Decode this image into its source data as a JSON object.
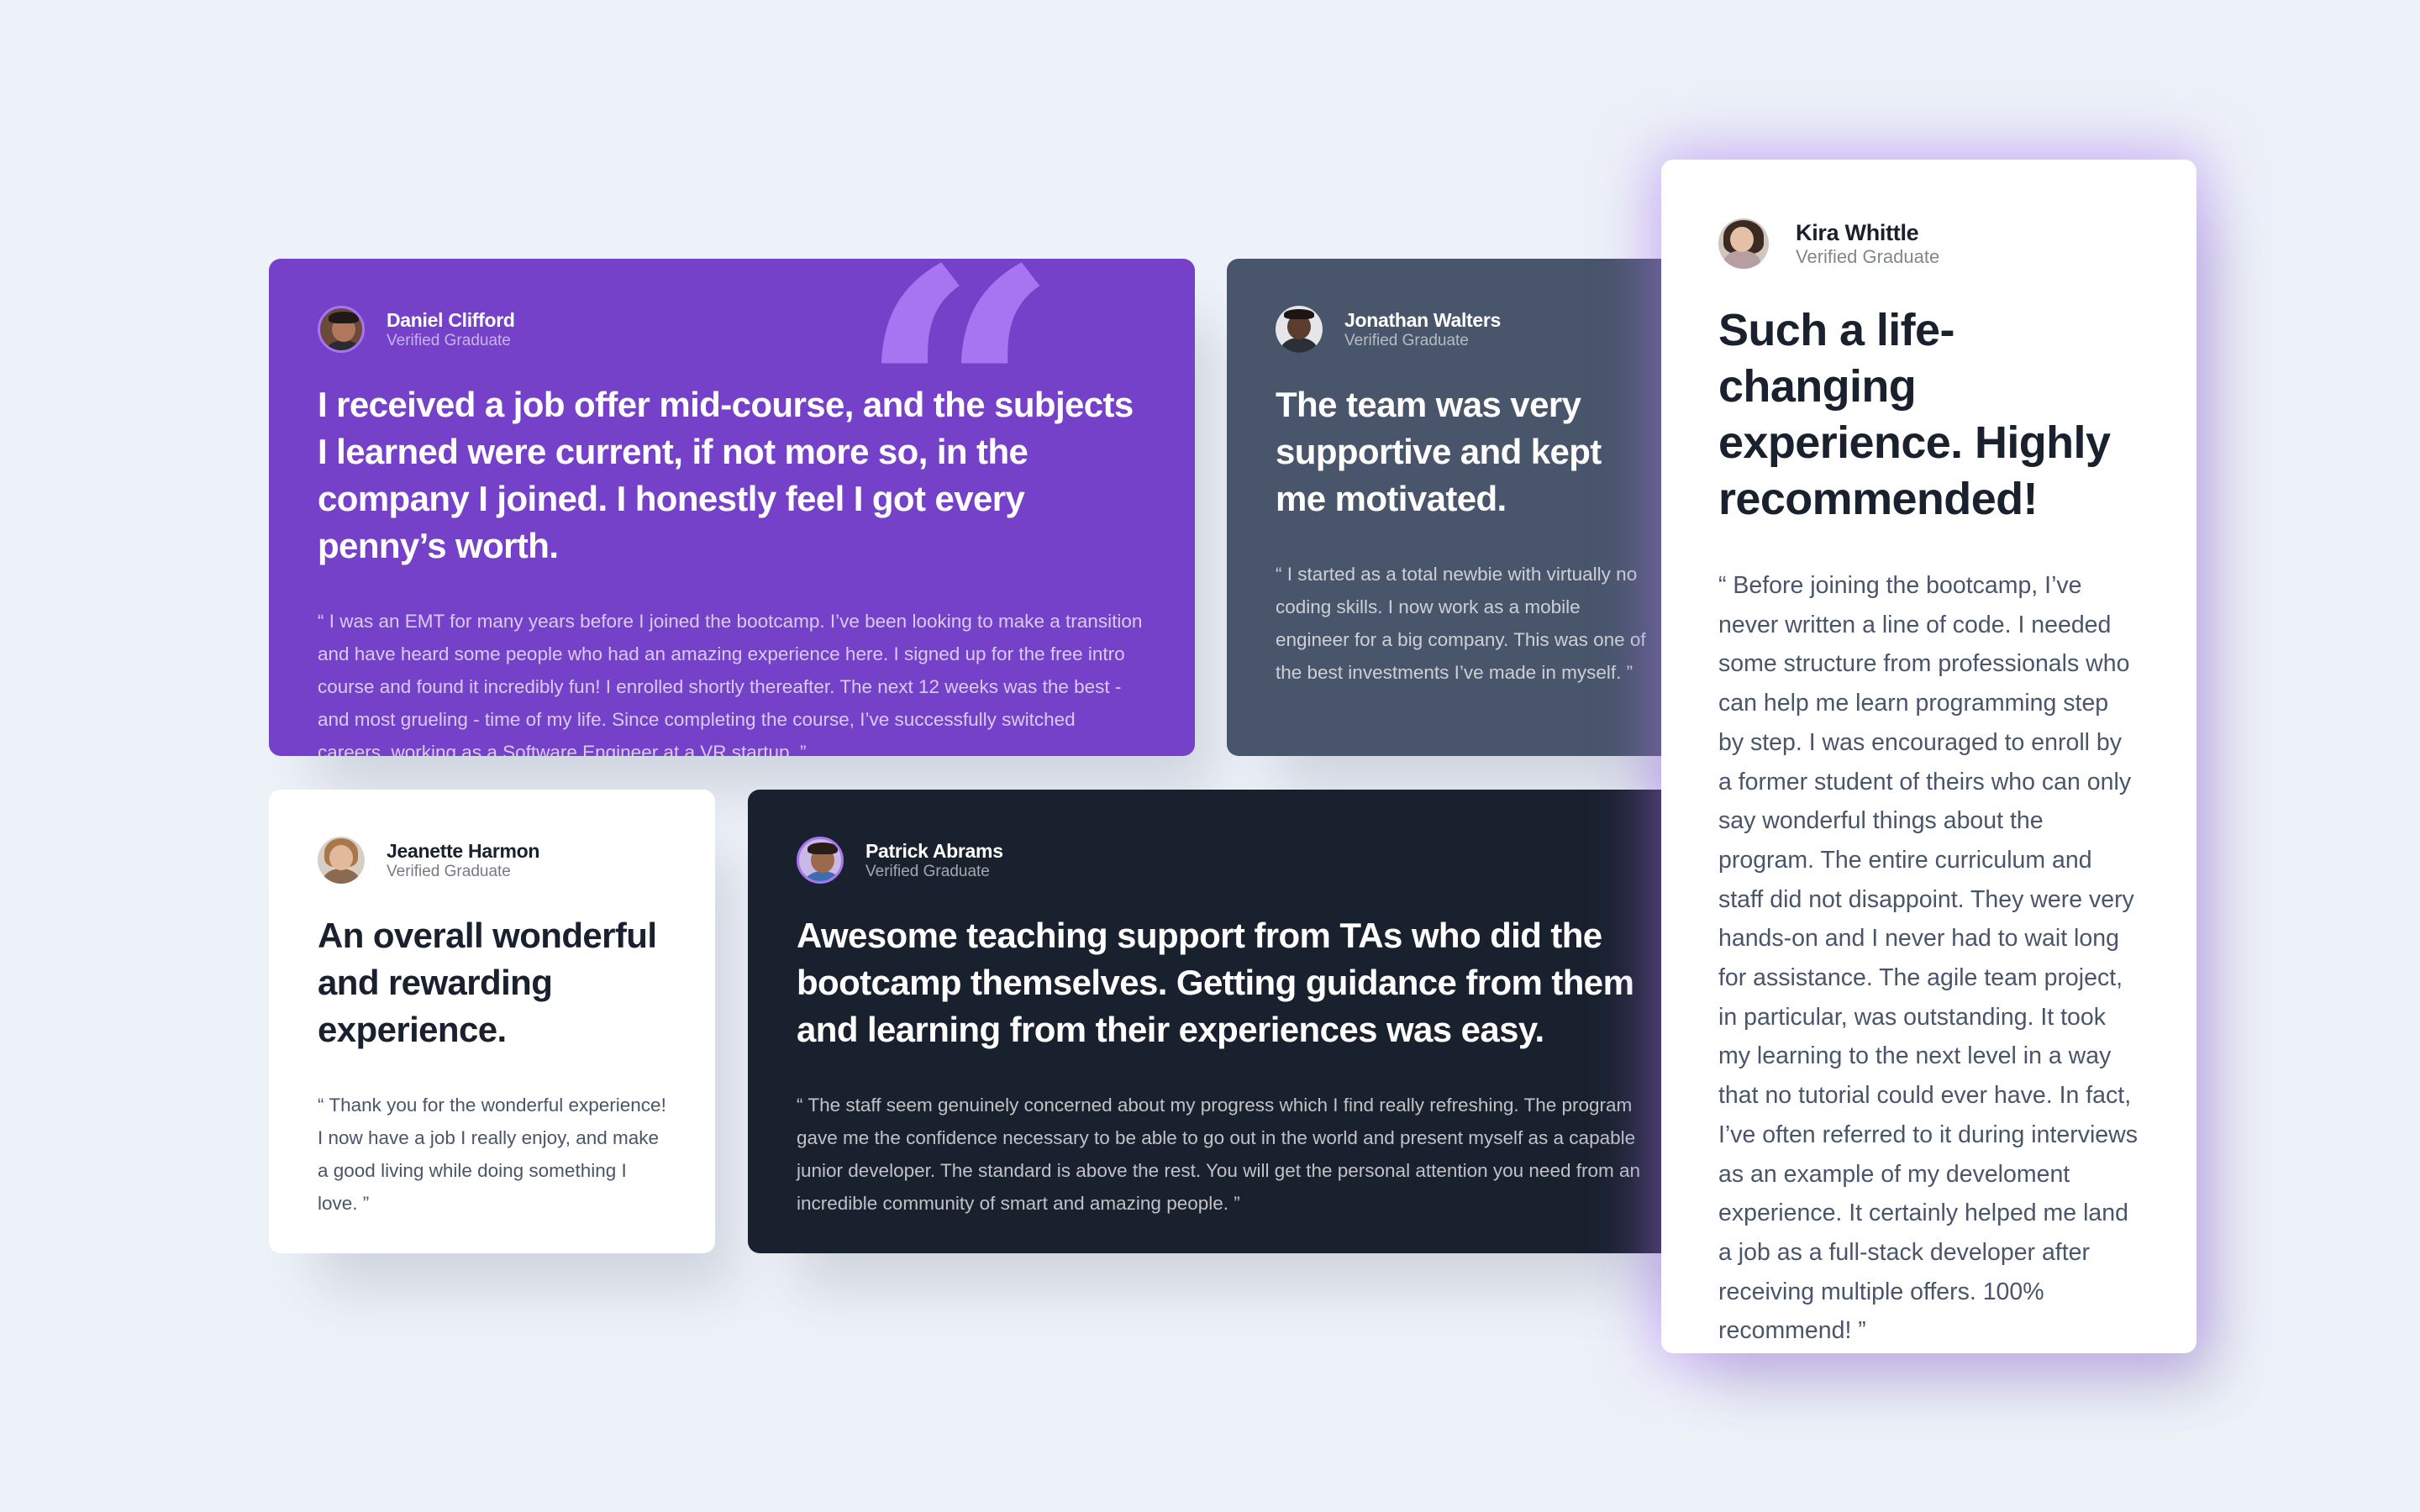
{
  "colors": {
    "page_background": "#edf1f8",
    "purple": "#7541c8",
    "gray_blue": "#48556a",
    "dark_blue": "#19212e",
    "white": "#ffffff",
    "light_purple": "#a775f1"
  },
  "testimonials": [
    {
      "name": "Daniel Clifford",
      "status": "Verified Graduate",
      "headline": "I received a job offer mid-course, and the subjects I learned were current, if not more so, in the company I joined. I honestly feel I got every penny’s worth.",
      "quote": "“ I was an EMT for many years before I joined the bootcamp. I’ve been looking to make a transition and have heard some people who had an amazing experience here. I signed up for the free intro course and found it incredibly fun! I enrolled shortly thereafter. The next 12 weeks was the best - and most grueling - time of my life. Since completing the course, I’ve successfully switched careers, working as a Software Engineer at a VR startup. ”",
      "avatar_icon": "user-avatar-icon",
      "decorative_quote_icon": "quotation-mark-icon"
    },
    {
      "name": "Jonathan Walters",
      "status": "Verified Graduate",
      "headline": "The team was very supportive and kept me motivated.",
      "quote": "“ I started as a total newbie with virtually no coding skills. I now work as a mobile engineer for a big company. This was one of the best investments I’ve made in myself. ”",
      "avatar_icon": "user-avatar-icon"
    },
    {
      "name": "Jeanette Harmon",
      "status": "Verified Graduate",
      "headline": "An overall wonderful and rewarding experience.",
      "quote": "“ Thank you for the wonderful experience! I now have a job I really enjoy, and make a good living while doing something I love. ”",
      "avatar_icon": "user-avatar-icon"
    },
    {
      "name": "Patrick Abrams",
      "status": "Verified Graduate",
      "headline": "Awesome teaching support from TAs who did the bootcamp themselves. Getting guidance from them and learning from their experiences was easy.",
      "quote": "“ The staff seem genuinely concerned about my progress which I find really refreshing. The program gave me the confidence necessary to be able to go out in the world and present myself as a capable junior developer. The standard is above the rest. You will get the personal attention you need from an incredible community of smart and amazing people. ”",
      "avatar_icon": "user-avatar-icon"
    },
    {
      "name": "Kira Whittle",
      "status": "Verified Graduate",
      "headline": "Such a life-changing experience. Highly recommended!",
      "quote": "“ Before joining the bootcamp, I’ve never written a line of code. I needed some structure from professionals who can help me learn programming step by step. I was encouraged to enroll by a former student of theirs who can only say wonderful things about the program. The entire curriculum and staff did not disappoint. They were very hands-on and I never had to wait long for assistance. The agile team project, in particular, was outstanding. It took my learning to the next level in a way that no tutorial could ever have. In fact, I’ve often referred to it during interviews as an example of my develoment experience. It certainly helped me land a job as a full-stack developer after receiving multiple offers. 100% recommend! ”",
      "avatar_icon": "user-avatar-icon"
    }
  ]
}
